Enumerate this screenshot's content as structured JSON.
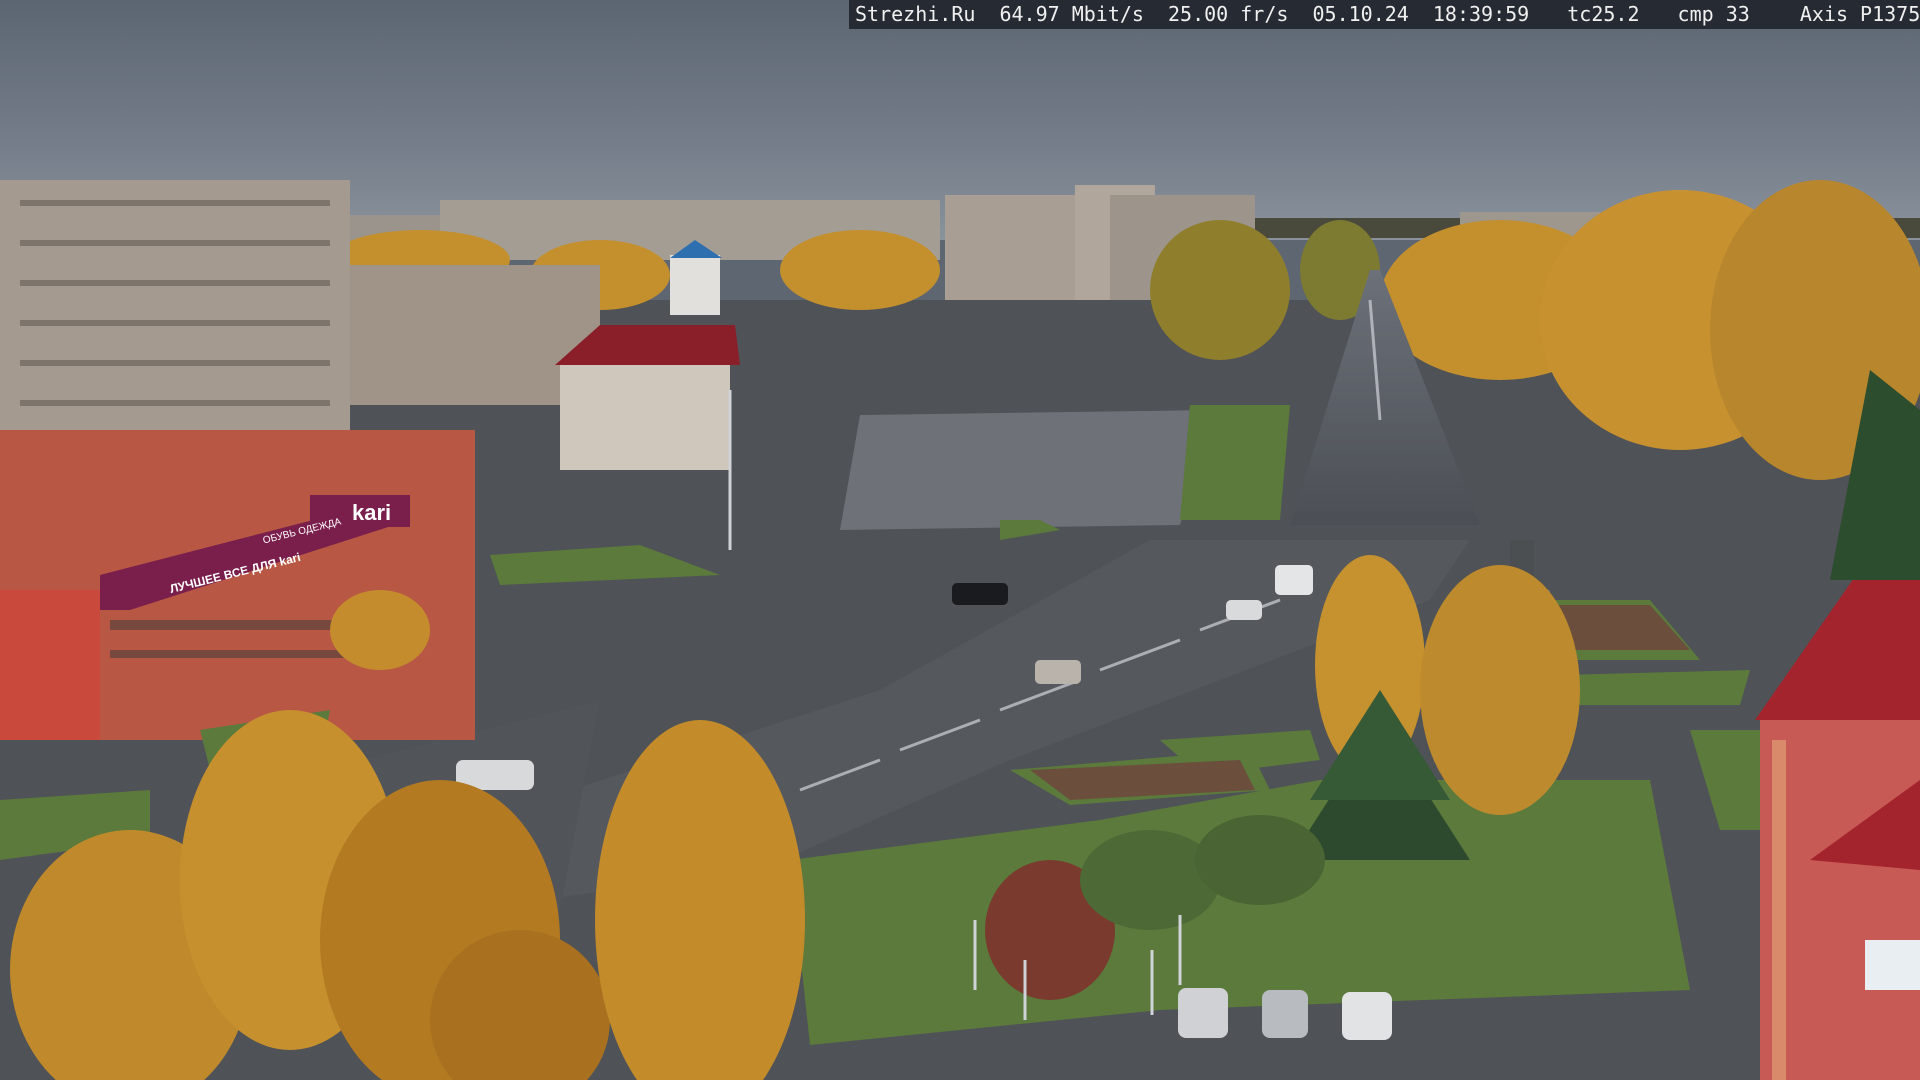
{
  "overlay": {
    "site": "Strezhi.Ru",
    "bitrate": "64.97 Mbit/s",
    "framerate": "25.00 fr/s",
    "date": "05.10.24",
    "time": "18:39:59",
    "tc": "tc25.2",
    "cmp": "cmp 33",
    "camera": "Axis P1375"
  },
  "signs": {
    "store_main": "kari",
    "store_side": "ОБУВЬ ОДЕЖДА",
    "store_lower": "ЛУЧШЕЕ ВСЕ ДЛЯ kari"
  },
  "colors": {
    "sky": "#6a7380",
    "foliage": "#c98f2a",
    "grass": "#5c7a3e",
    "asphalt": "#5a5e64",
    "store_facade": "#b85844",
    "store_banner": "#7a1f4c",
    "roof_red": "#a3242c",
    "overlay_bg": "#262b33"
  }
}
